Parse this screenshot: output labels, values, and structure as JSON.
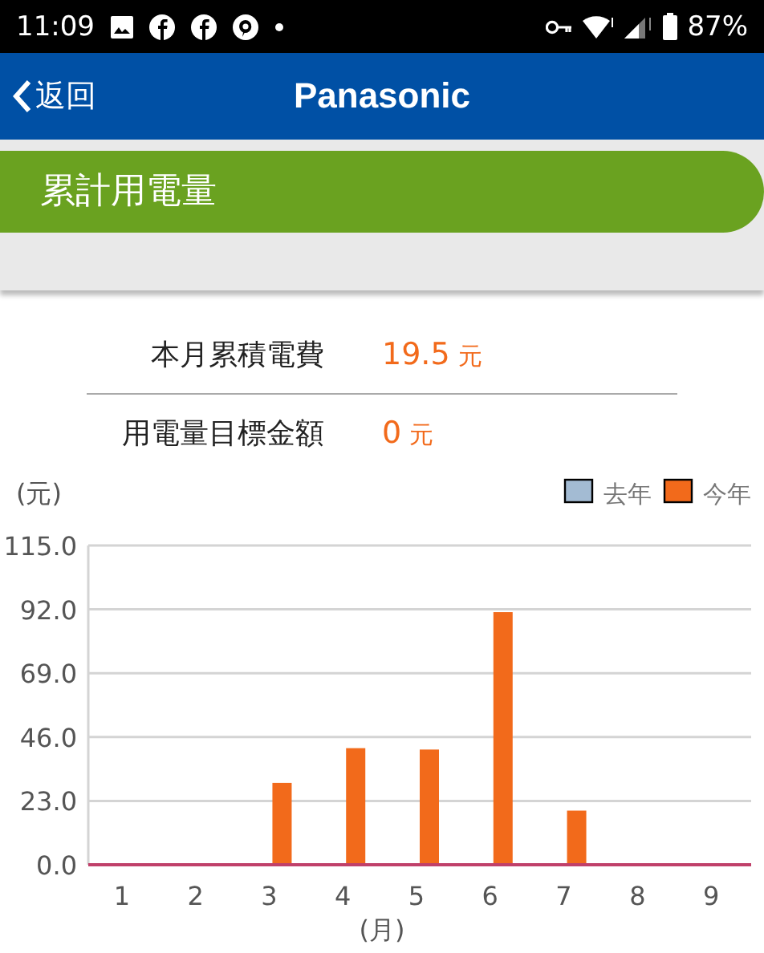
{
  "status_bar": {
    "time": "11:09",
    "battery": "87%"
  },
  "header": {
    "back": "返回",
    "title": "Panasonic"
  },
  "section_title": "累計用電量",
  "summary": [
    {
      "label": "本月累積電費",
      "value": "19.5",
      "unit": "元"
    },
    {
      "label": "用電量目標金額",
      "value": "0",
      "unit": "元"
    }
  ],
  "chart": {
    "chart_data": {
      "type": "bar",
      "ylabel": "(元)",
      "xlabel": "(月)",
      "categories": [
        "1",
        "2",
        "3",
        "4",
        "5",
        "6",
        "7",
        "8",
        "9"
      ],
      "series": [
        {
          "name": "去年",
          "color": "#a3bbd3",
          "values": [
            null,
            null,
            null,
            null,
            null,
            null,
            null,
            null,
            null
          ]
        },
        {
          "name": "今年",
          "color": "#f26a1b",
          "values": [
            0,
            0,
            29.5,
            42,
            41.5,
            91,
            19.5,
            0,
            0
          ]
        }
      ],
      "ylim": [
        0,
        115
      ],
      "grid": true,
      "yticks": [
        {
          "value": 0,
          "label": "0.0"
        },
        {
          "value": 23,
          "label": "23.0"
        },
        {
          "value": 46,
          "label": "46.0"
        },
        {
          "value": 69,
          "label": "69.0"
        },
        {
          "value": 92,
          "label": "92.0"
        },
        {
          "value": 115,
          "label": "115.0"
        }
      ]
    }
  }
}
